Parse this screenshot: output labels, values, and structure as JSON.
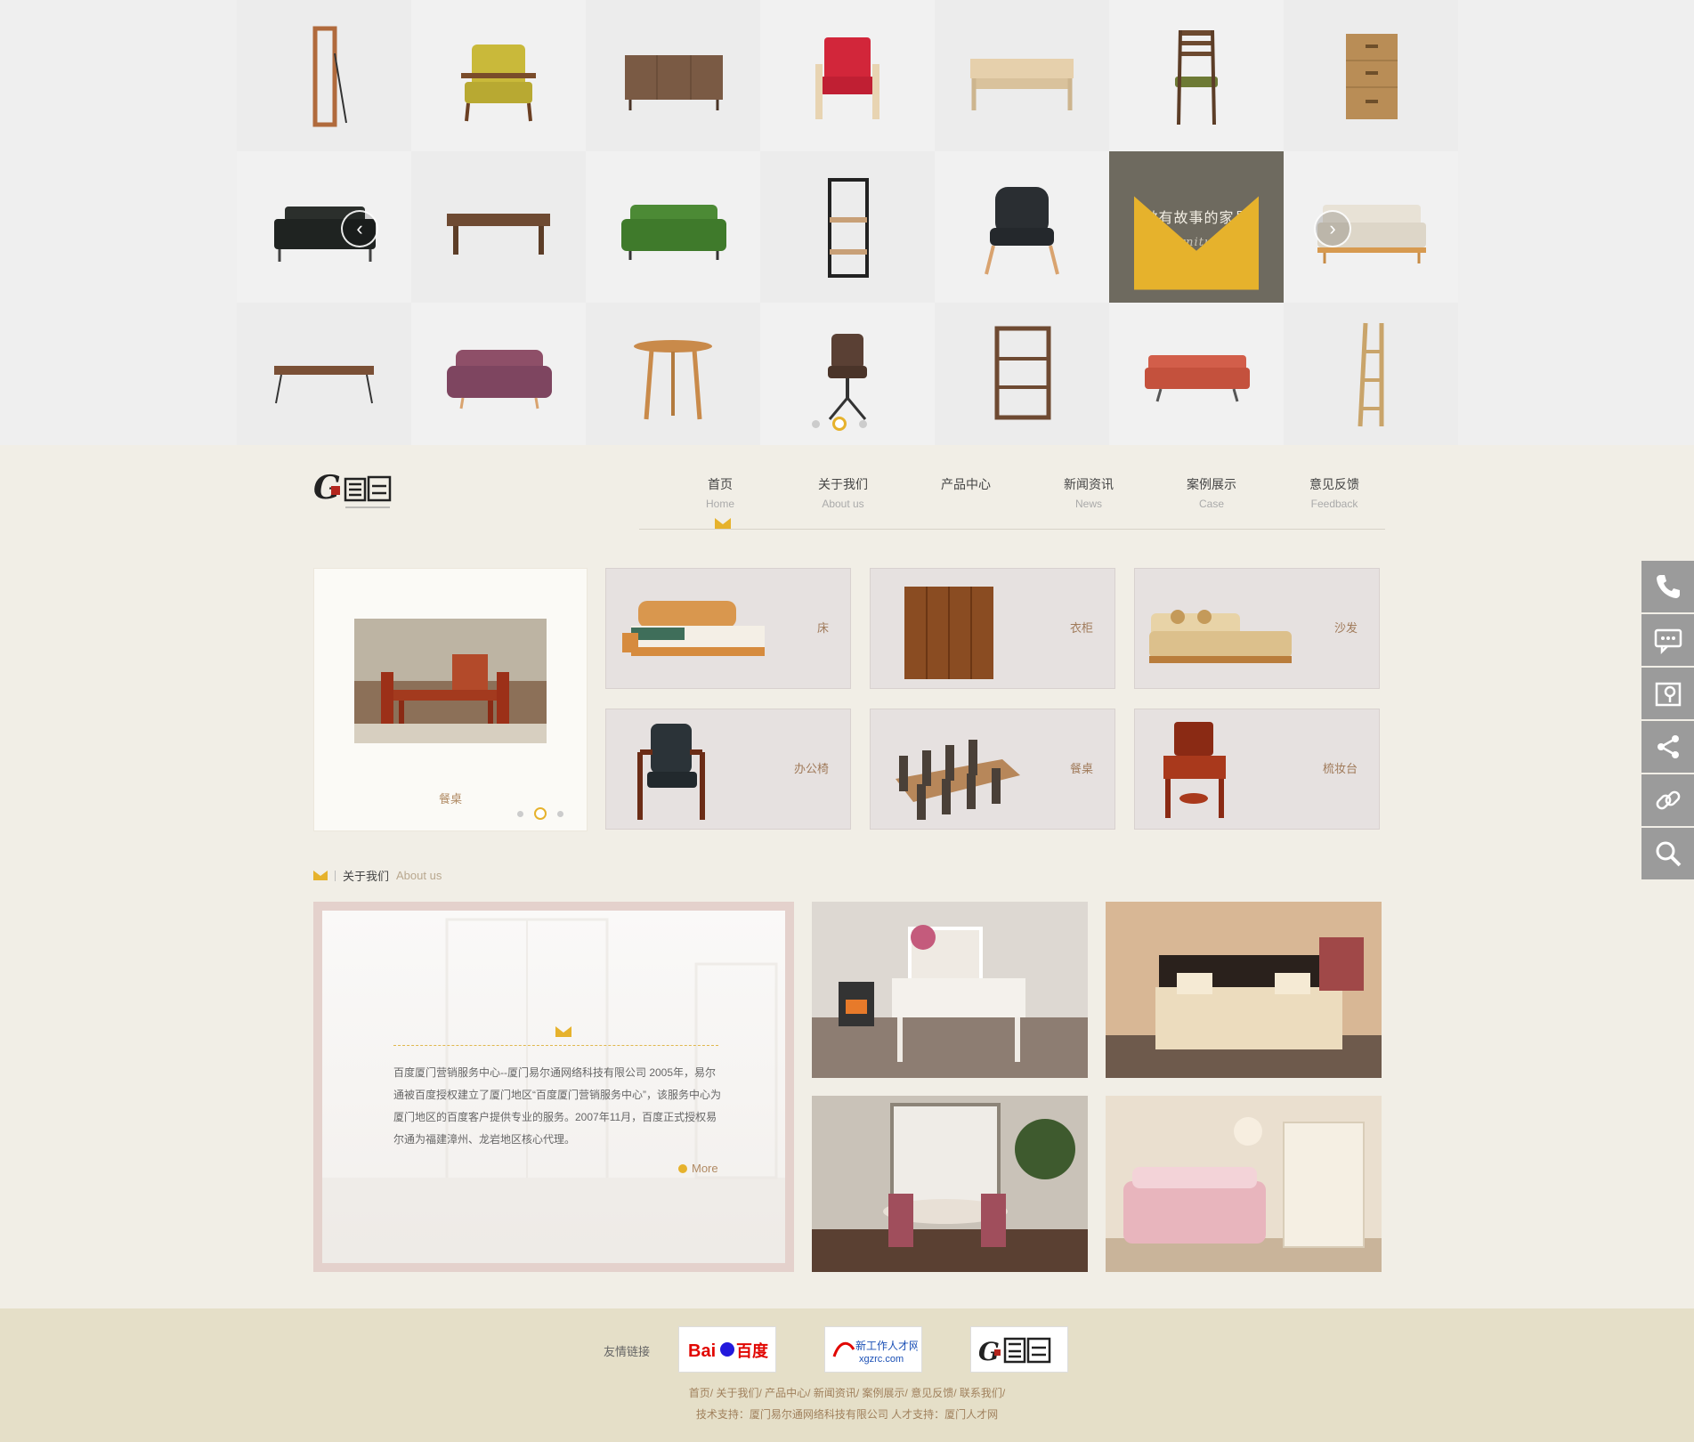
{
  "hero": {
    "feature_title": "做有故事的家具",
    "feature_subtitle": "furniture",
    "prev_arrow": "‹",
    "next_arrow": "›"
  },
  "nav": {
    "items": [
      {
        "cn": "首页",
        "en": "Home"
      },
      {
        "cn": "关于我们",
        "en": "About us"
      },
      {
        "cn": "产品中心",
        "en": ""
      },
      {
        "cn": "新闻资讯",
        "en": "News"
      },
      {
        "cn": "案例展示",
        "en": "Case"
      },
      {
        "cn": "意见反馈",
        "en": "Feedback"
      }
    ]
  },
  "products": {
    "slider_label": "餐桌",
    "categories": [
      "床",
      "衣柜",
      "沙发",
      "办公椅",
      "餐桌",
      "梳妆台"
    ]
  },
  "about": {
    "title_cn": "关于我们",
    "title_en": "About us",
    "text": "百度厦门营销服务中心--厦门易尔通网络科技有限公司 2005年，易尔通被百度授权建立了厦门地区“百度厦门营销服务中心”，该服务中心为厦门地区的百度客户提供专业的服务。2007年11月，百度正式授权易尔通为福建漳州、龙岩地区核心代理。",
    "more": "More"
  },
  "footer": {
    "friends_label": "友情链接",
    "nav_links": [
      "首页/",
      "关于我们/",
      "产品中心/",
      "新闻资讯/",
      "案例展示/",
      "意见反馈/",
      "联系我们/"
    ],
    "copyright": "技术支持：厦门易尔通网络科技有限公司 人才支持：厦门人才网"
  },
  "side_tools": [
    "phone-icon",
    "chat-icon",
    "map-icon",
    "share-icon",
    "link-icon",
    "search-icon"
  ],
  "colors": {
    "accent": "#e6b22c",
    "feature_bg": "#6e6a5f",
    "footer_bg": "#e5dfc8",
    "side_bg": "#9b9b9b"
  }
}
